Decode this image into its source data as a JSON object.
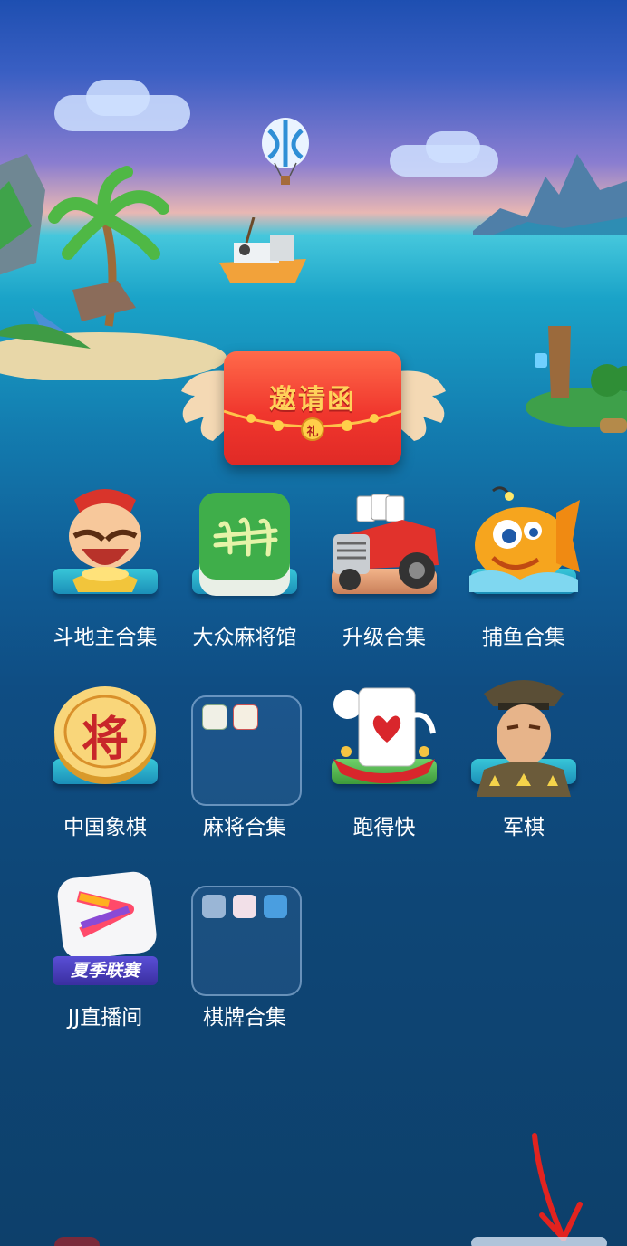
{
  "invite": {
    "title": "邀请函",
    "seal": "礼"
  },
  "apps": [
    {
      "label": "斗地主合集",
      "icon": "landlord-character-icon"
    },
    {
      "label": "大众麻将馆",
      "icon": "mahjong-tile-icon"
    },
    {
      "label": "升级合集",
      "icon": "tractor-cards-icon"
    },
    {
      "label": "捕鱼合集",
      "icon": "goldfish-icon"
    },
    {
      "label": "中国象棋",
      "icon": "chinese-chess-piece-icon",
      "glyph": "将"
    },
    {
      "label": "麻将合集",
      "icon": "folder-icon"
    },
    {
      "label": "跑得快",
      "icon": "playing-card-icon"
    },
    {
      "label": "军棋",
      "icon": "army-officer-icon"
    },
    {
      "label": "JJ直播间",
      "icon": "jj-live-icon",
      "badge": "夏季联赛"
    },
    {
      "label": "棋牌合集",
      "icon": "folder-icon"
    }
  ],
  "colors": {
    "accent_red": "#f0362d",
    "gold": "#ffd25a",
    "pedestal": "#2ab0cc"
  }
}
